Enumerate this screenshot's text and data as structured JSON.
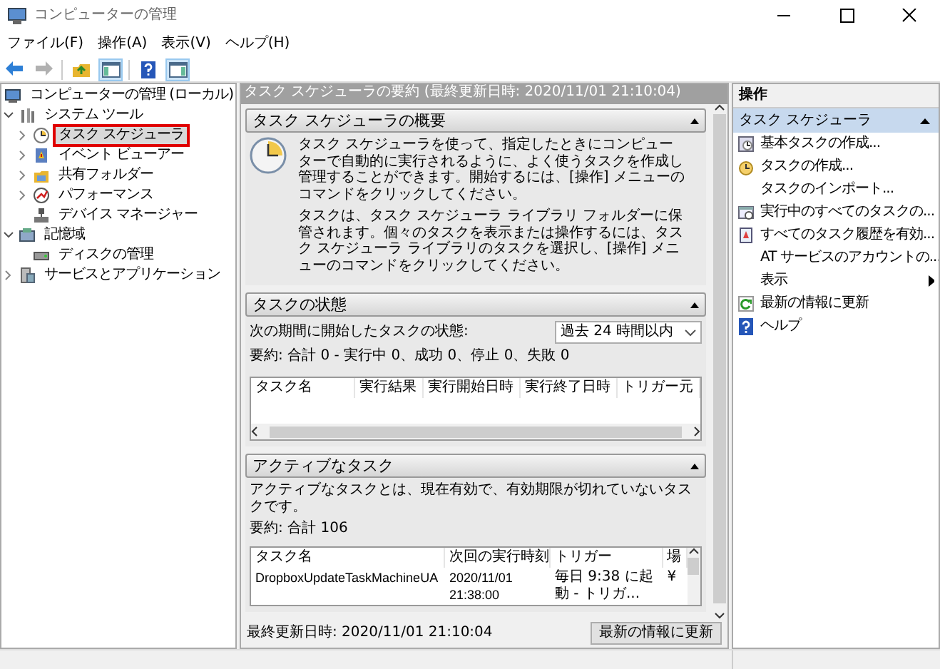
{
  "window": {
    "title": "コンピューターの管理"
  },
  "menu": [
    "ファイル(F)",
    "操作(A)",
    "表示(V)",
    "ヘルプ(H)"
  ],
  "toolbar": [
    {
      "kind": "back",
      "disabled": false,
      "pressed": false
    },
    {
      "kind": "forward",
      "disabled": true,
      "pressed": false
    },
    {
      "kind": "up",
      "disabled": false,
      "pressed": false
    },
    {
      "kind": "tree-toggle",
      "disabled": false,
      "pressed": true
    },
    {
      "kind": "help",
      "disabled": false,
      "pressed": false
    },
    {
      "kind": "pane-toggle",
      "disabled": false,
      "pressed": true
    }
  ],
  "tree": [
    {
      "label": "コンピューターの管理 (ローカル)",
      "kind": "computer",
      "selected": false,
      "children": [
        {
          "label": "システム ツール",
          "kind": "tools",
          "expanded": true,
          "selected": false,
          "children": [
            {
              "label": "タスク スケジューラ",
              "kind": "clock",
              "expanded": false,
              "selected": true
            },
            {
              "label": "イベント ビューアー",
              "kind": "event",
              "expanded": false,
              "selected": false
            },
            {
              "label": "共有フォルダー",
              "kind": "share",
              "expanded": false,
              "selected": false
            },
            {
              "label": "パフォーマンス",
              "kind": "perf",
              "expanded": false,
              "selected": false
            },
            {
              "label": "デバイス マネージャー",
              "kind": "device",
              "selected": false
            }
          ]
        },
        {
          "label": "記憶域",
          "kind": "storage",
          "expanded": true,
          "selected": false,
          "children": [
            {
              "label": "ディスクの管理",
              "kind": "disk",
              "selected": false
            }
          ]
        },
        {
          "label": "サービスとアプリケーション",
          "kind": "services",
          "expanded": false,
          "selected": false
        }
      ]
    }
  ],
  "center": {
    "header": "タスク スケジューラの要約 (最終更新日時: 2020/11/01 21:10:04)",
    "overview": {
      "title": "タスク スケジューラの概要",
      "paragraphs": [
        "タスク スケジューラを使って、指定したときにコンピューターで自動的に実行されるように、よく使うタスクを作成し管理することができます。開始するには、[操作] メニューのコマンドをクリックしてください。",
        "タスクは、タスク スケジューラ ライブラリ フォルダーに保管されます。個々のタスクを表示または操作するには、タスク スケジューラ ライブラリのタスクを選択し、[操作] メニューのコマンドをクリックしてください。"
      ]
    },
    "status": {
      "title": "タスクの状態",
      "label": "次の期間に開始したタスクの状態:",
      "period": "過去 24 時間以内",
      "summary": "要約: 合計 0 - 実行中 0、成功 0、停止 0、失敗 0",
      "table": {
        "columns": [
          "タスク名",
          "実行結果",
          "実行開始日時",
          "実行終了日時",
          "トリガー元"
        ]
      }
    },
    "active": {
      "title": "アクティブなタスク",
      "description": "アクティブなタスクとは、現在有効で、有効期限が切れていないタスクです。",
      "summary": "要約: 合計 106",
      "table": {
        "columns": [
          "タスク名",
          "次回の実行時刻",
          "トリガー",
          "場"
        ],
        "rows": [
          [
            "DropboxUpdateTaskMachineUA",
            "2020/11/01 21:38:00",
            "毎日 9:38 に起動 - トリガ...",
            "¥"
          ]
        ]
      }
    },
    "footer": {
      "last_updated": "最終更新日時: 2020/11/01 21:10:04",
      "refresh_button": "最新の情報に更新"
    }
  },
  "actions": {
    "title": "操作",
    "section": "タスク スケジューラ",
    "items": [
      {
        "label": "基本タスクの作成...",
        "kind": "basic-task"
      },
      {
        "label": "タスクの作成...",
        "kind": "create-task"
      },
      {
        "label": "タスクのインポート...",
        "kind": "plain"
      },
      {
        "label": "実行中のすべてのタスクの...",
        "kind": "running"
      },
      {
        "label": "すべてのタスク履歴を有効...",
        "kind": "history"
      },
      {
        "label": "AT サービスのアカウントの...",
        "kind": "plain"
      },
      {
        "label": "表示",
        "kind": "submenu"
      },
      {
        "label": "最新の情報に更新",
        "kind": "refresh"
      },
      {
        "label": "ヘルプ",
        "kind": "help"
      }
    ]
  }
}
